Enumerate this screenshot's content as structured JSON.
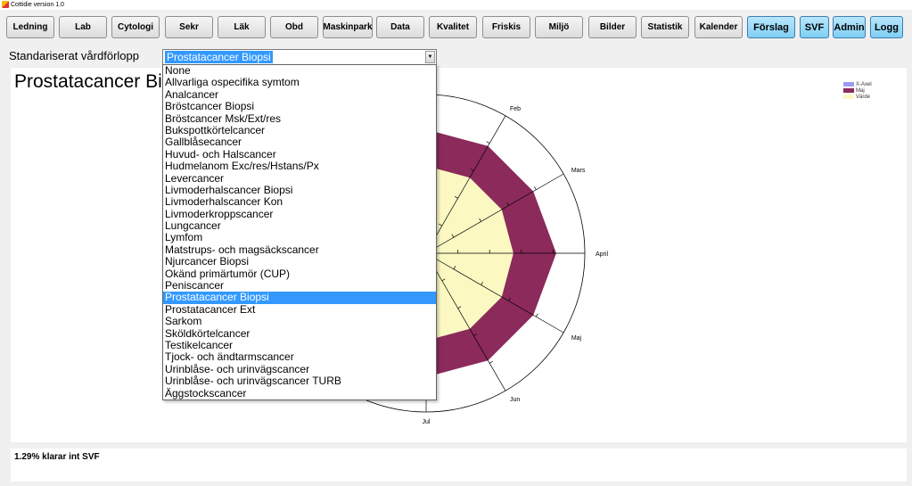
{
  "window": {
    "title": "Cottidie version 1.0"
  },
  "nav": [
    {
      "label": "Ledning"
    },
    {
      "label": "Lab"
    },
    {
      "label": "Cytologi"
    },
    {
      "label": "Sekr"
    },
    {
      "label": "Läk"
    },
    {
      "label": "Obd"
    },
    {
      "label": "Maskinpark"
    },
    {
      "label": "Data"
    },
    {
      "label": "Kvalitet"
    },
    {
      "label": "Friskis"
    },
    {
      "label": "Miljö"
    },
    {
      "label": "Bilder"
    },
    {
      "label": "Statistik"
    },
    {
      "label": "Kalender"
    },
    {
      "label": "Förslag"
    },
    {
      "label": "SVF"
    },
    {
      "label": "Admin"
    },
    {
      "label": "Logg"
    }
  ],
  "selector": {
    "label": "Standariserat vårdförlopp",
    "selected": "Prostatacancer Biopsi",
    "options": [
      "None",
      "Allvarliga ospecifika symtom",
      "Analcancer",
      "Bröstcancer Biopsi",
      "Bröstcancer Msk/Ext/res",
      "Bukspottkörtelcancer",
      "Gallblåsecancer",
      "Huvud- och Halscancer",
      "Hudmelanom Exc/res/Hstans/Px",
      "Levercancer",
      "Livmoderhalscancer Biopsi",
      "Livmoderhalscancer Kon",
      "Livmoderkroppscancer",
      "Lungcancer",
      "Lymfom",
      "Matstrups- och magsäckscancer",
      "Njurcancer Biopsi",
      "Okänd primärtumör (CUP)",
      "Peniscancer",
      "Prostatacancer Biopsi",
      "Prostatacancer Ext",
      "Sarkom",
      "Sköldkörtelcancer",
      "Testikelcancer",
      "Tjock- och ändtarmscancer",
      "Urinblåse- och urinvägscancer",
      "Urinblåse- och urinvägscancer TURB",
      "Äggstockscancer"
    ]
  },
  "chart_title": "Prostatacancer Bi",
  "chart_data": {
    "type": "radar",
    "categories": [
      "Feb",
      "Mars",
      "April",
      "Maj",
      "Jun",
      "Jul"
    ],
    "series": [
      {
        "name": "X-Axel"
      },
      {
        "name": "Maj",
        "values": [
          0.78,
          0.78,
          0.82,
          0.78,
          0.78,
          0.78
        ]
      },
      {
        "name": "Värde",
        "values": [
          0.55,
          0.55,
          0.55,
          0.55,
          0.55,
          0.55
        ]
      }
    ],
    "legend_position": "top-right",
    "colors": {
      "X-Axel": "#9b9bf5",
      "Maj": "#8b2a5b",
      "Värde": "#fbf8c2"
    }
  },
  "status": {
    "text": "1.29% klarar int SVF"
  }
}
